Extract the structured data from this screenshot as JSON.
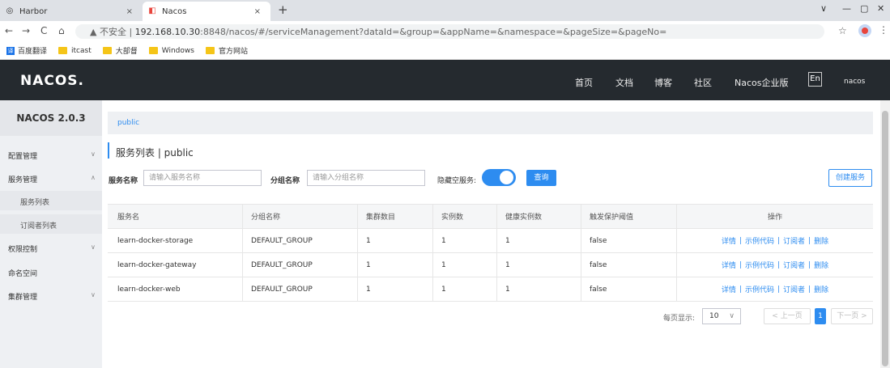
{
  "browser": {
    "tabs": [
      {
        "title": "Harbor",
        "icon": "harbor-icon",
        "close": "×"
      },
      {
        "title": "Nacos",
        "icon": "nacos-icon",
        "close": "×"
      }
    ],
    "new_tab": "+",
    "window_controls": {
      "minimize": "—",
      "maximize": "▢",
      "close": "✕",
      "dropdown": "∨"
    },
    "nav": {
      "back": "←",
      "forward": "→",
      "reload": "C",
      "home": "⌂"
    },
    "security_label": "▲ 不安全 |",
    "url_host": "192.168.10.30",
    "url_rest": ":8848/nacos/#/serviceManagement?dataId=&group=&appName=&namespace=&pageSize=&pageNo=",
    "star": "☆",
    "menu": "⋮",
    "bookmarks": [
      {
        "label": "百度翻译",
        "icon": "translate-icon"
      },
      {
        "label": "itcast",
        "icon": "folder-icon"
      },
      {
        "label": "大部督",
        "icon": "folder-icon"
      },
      {
        "label": "Windows",
        "icon": "folder-icon"
      },
      {
        "label": "官方网站",
        "icon": "folder-icon"
      }
    ]
  },
  "header": {
    "logo": "NACOS.",
    "nav": [
      "首页",
      "文档",
      "博客",
      "社区",
      "Nacos企业版"
    ],
    "lang": "En",
    "user": "nacos"
  },
  "sidebar": {
    "title": "NACOS 2.0.3",
    "items": [
      {
        "label": "配置管理",
        "chevron": "∨"
      },
      {
        "label": "服务管理",
        "chevron": "∧"
      },
      {
        "label": "服务列表"
      },
      {
        "label": "订阅者列表"
      },
      {
        "label": "权限控制",
        "chevron": "∨"
      },
      {
        "label": "命名空间"
      },
      {
        "label": "集群管理",
        "chevron": "∨"
      }
    ]
  },
  "main": {
    "breadcrumb": "public",
    "title": "服务列表  |  public",
    "filters": {
      "service_label": "服务名称",
      "service_placeholder": "请输入服务名称",
      "group_label": "分组名称",
      "group_placeholder": "请输入分组名称",
      "hide_empty_label": "隐藏空服务:",
      "hide_empty_on": true,
      "query_button": "查询",
      "create_button": "创建服务"
    },
    "table": {
      "headers": [
        "服务名",
        "分组名称",
        "集群数目",
        "实例数",
        "健康实例数",
        "触发保护阈值",
        "操作"
      ],
      "rows": [
        [
          "learn-docker-storage",
          "DEFAULT_GROUP",
          "1",
          "1",
          "1",
          "false"
        ],
        [
          "learn-docker-gateway",
          "DEFAULT_GROUP",
          "1",
          "1",
          "1",
          "false"
        ],
        [
          "learn-docker-web",
          "DEFAULT_GROUP",
          "1",
          "1",
          "1",
          "false"
        ]
      ],
      "actions": [
        "详情",
        "示例代码",
        "订阅者",
        "删除"
      ],
      "action_sep": "|"
    },
    "pagination": {
      "per_page_label": "每页显示:",
      "per_page": "10",
      "chevron": "∨",
      "prev": "< 上一页",
      "page": "1",
      "next": "下一页 >"
    }
  },
  "colors": {
    "accent": "#2d8cf0",
    "header_bg": "#252a2f",
    "sidebar_bg": "#eef0f3"
  }
}
